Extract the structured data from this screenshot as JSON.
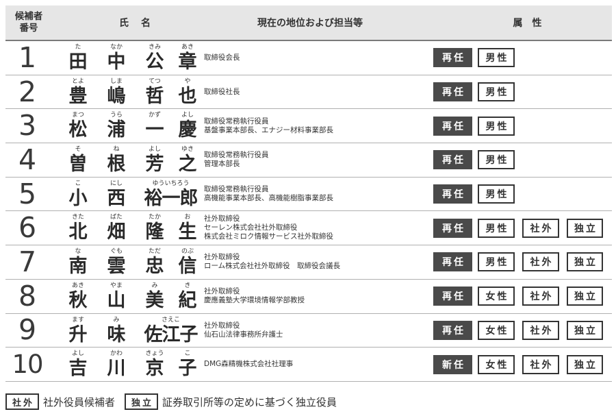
{
  "header": {
    "num": "候補者\n番号",
    "name": "氏名",
    "position": "現在の地位および担当等",
    "attributes": "属性"
  },
  "candidates": [
    {
      "num": "1",
      "chars": [
        [
          "た",
          "田"
        ],
        [
          "なか",
          "中"
        ],
        [
          "きみ",
          "公"
        ],
        [
          "あき",
          "章"
        ]
      ],
      "positions": [
        "取締役会長"
      ],
      "status": "再任",
      "sex": "男性",
      "outside": "",
      "independent": ""
    },
    {
      "num": "2",
      "chars": [
        [
          "とよ",
          "豊"
        ],
        [
          "しま",
          "嶋"
        ],
        [
          "てつ",
          "哲"
        ],
        [
          "や",
          "也"
        ]
      ],
      "positions": [
        "取締役社長"
      ],
      "status": "再任",
      "sex": "男性",
      "outside": "",
      "independent": ""
    },
    {
      "num": "3",
      "chars": [
        [
          "まつ",
          "松"
        ],
        [
          "うら",
          "浦"
        ],
        [
          "かず",
          "一"
        ],
        [
          "よし",
          "慶"
        ]
      ],
      "positions": [
        "取締役常務執行役員",
        "基盤事業本部長、エナジー材料事業部長"
      ],
      "status": "再任",
      "sex": "男性",
      "outside": "",
      "independent": ""
    },
    {
      "num": "4",
      "chars": [
        [
          "そ",
          "曽"
        ],
        [
          "ね",
          "根"
        ],
        [
          "よし",
          "芳"
        ],
        [
          "ゆき",
          "之"
        ]
      ],
      "positions": [
        "取締役常務執行役員",
        "管理本部長"
      ],
      "status": "再任",
      "sex": "男性",
      "outside": "",
      "independent": ""
    },
    {
      "num": "5",
      "chars": [
        [
          "こ",
          "小"
        ],
        [
          "にし",
          "西"
        ],
        [
          "ゆういちろう",
          "裕一郎"
        ],
        [
          "",
          ""
        ]
      ],
      "positions": [
        "取締役常務執行役員",
        "高機能事業本部長、高機能樹脂事業部長"
      ],
      "status": "再任",
      "sex": "男性",
      "outside": "",
      "independent": ""
    },
    {
      "num": "6",
      "chars": [
        [
          "きた",
          "北"
        ],
        [
          "ばた",
          "畑"
        ],
        [
          "たか",
          "隆"
        ],
        [
          "お",
          "生"
        ]
      ],
      "positions": [
        "社外取締役",
        "セーレン株式会社社外取締役",
        "株式会社ミロク情報サービス社外取締役"
      ],
      "status": "再任",
      "sex": "男性",
      "outside": "社外",
      "independent": "独立"
    },
    {
      "num": "7",
      "chars": [
        [
          "な",
          "南"
        ],
        [
          "ぐも",
          "雲"
        ],
        [
          "ただ",
          "忠"
        ],
        [
          "のぶ",
          "信"
        ]
      ],
      "positions": [
        "社外取締役",
        "ローム株式会社社外取締役　取締役会議長"
      ],
      "status": "再任",
      "sex": "男性",
      "outside": "社外",
      "independent": "独立"
    },
    {
      "num": "8",
      "chars": [
        [
          "あき",
          "秋"
        ],
        [
          "やま",
          "山"
        ],
        [
          "み",
          "美"
        ],
        [
          "き",
          "紀"
        ]
      ],
      "positions": [
        "社外取締役",
        "慶應義塾大学環境情報学部教授"
      ],
      "status": "再任",
      "sex": "女性",
      "outside": "社外",
      "independent": "独立"
    },
    {
      "num": "9",
      "chars": [
        [
          "ます",
          "升"
        ],
        [
          "み",
          "味"
        ],
        [
          "さえこ",
          "佐江子"
        ],
        [
          "",
          ""
        ]
      ],
      "positions": [
        "社外取締役",
        "仙石山法律事務所弁護士"
      ],
      "status": "再任",
      "sex": "女性",
      "outside": "社外",
      "independent": "独立"
    },
    {
      "num": "10",
      "chars": [
        [
          "よし",
          "吉"
        ],
        [
          "かわ",
          "川"
        ],
        [
          "きょう",
          "京"
        ],
        [
          "こ",
          "子"
        ]
      ],
      "positions": [
        "DMG森精機株式会社社理事"
      ],
      "status": "新任",
      "sex": "女性",
      "outside": "社外",
      "independent": "独立"
    }
  ],
  "legend": [
    {
      "badge": "社外",
      "text": "社外役員候補者"
    },
    {
      "badge": "独立",
      "text": "証券取引所等の定めに基づく独立役員"
    }
  ]
}
